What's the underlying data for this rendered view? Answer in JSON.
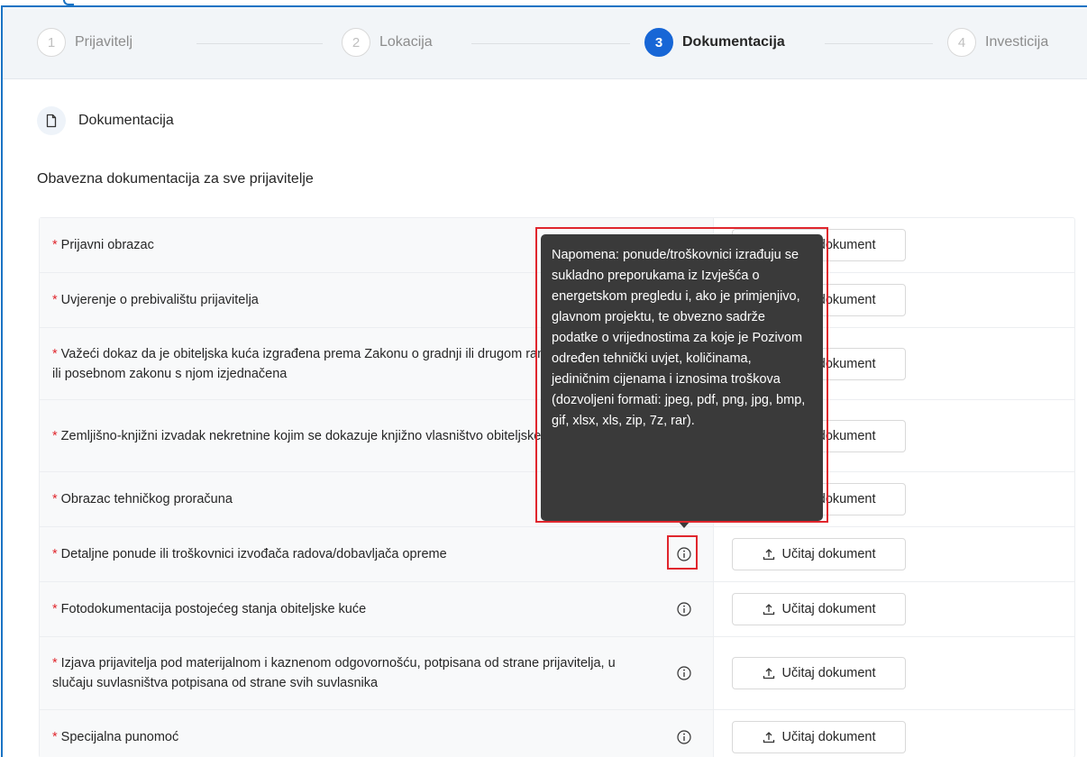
{
  "steps": [
    {
      "num": "1",
      "label": "Prijavitelj"
    },
    {
      "num": "2",
      "label": "Lokacija"
    },
    {
      "num": "3",
      "label": "Dokumentacija"
    },
    {
      "num": "4",
      "label": "Investicija"
    }
  ],
  "section": {
    "title": "Dokumentacija",
    "icon": "document-icon"
  },
  "subheading": "Obavezna dokumentacija za sve prijavitelje",
  "upload_label": "Učitaj dokument",
  "required_mark": "*",
  "documents": [
    {
      "label": "Prijavni obrazac"
    },
    {
      "label": "Uvjerenje o prebivalištu prijavitelja"
    },
    {
      "label": "Važeći dokaz da je obiteljska kuća izgrađena prema Zakonu o gradnji ili drugom ranije navedenom ili posebnom zakonu s njom izjednačena"
    },
    {
      "label": "Zemljišno-knjižni izvadak nekretnine kojim se dokazuje knjižno vlasništvo obiteljske kuće"
    },
    {
      "label": "Obrazac tehničkog proračuna"
    },
    {
      "label": "Detaljne ponude ili troškovnici izvođača radova/dobavljača opreme"
    },
    {
      "label": "Fotodokumentacija postojećeg stanja obiteljske kuće"
    },
    {
      "label": "Izjava prijavitelja pod materijalnom i kaznenom odgovornošću, potpisana od strane prijavitelja, u slučaju suvlasništva potpisana od strane svih suvlasnika"
    },
    {
      "label": "Specijalna punomoć"
    }
  ],
  "tooltip": "Napomena: ponude/troškovnici izrađuju se sukladno preporukama iz Izvješća o energetskom pregledu i, ako je primjenjivo, glavnom projektu, te obvezno sadrže podatke o vrijednostima za koje je Pozivom određen tehnički uvjet, količinama, jediničnim cijenama i iznosima troškova (dozvoljeni formati: jpeg, pdf, png, jpg, bmp, gif, xlsx, xls, zip, 7z, rar).",
  "colors": {
    "accent": "#1766d6",
    "required": "#e0262d",
    "highlight": "#e0262d",
    "tooltip_bg": "#3a3a3a"
  }
}
